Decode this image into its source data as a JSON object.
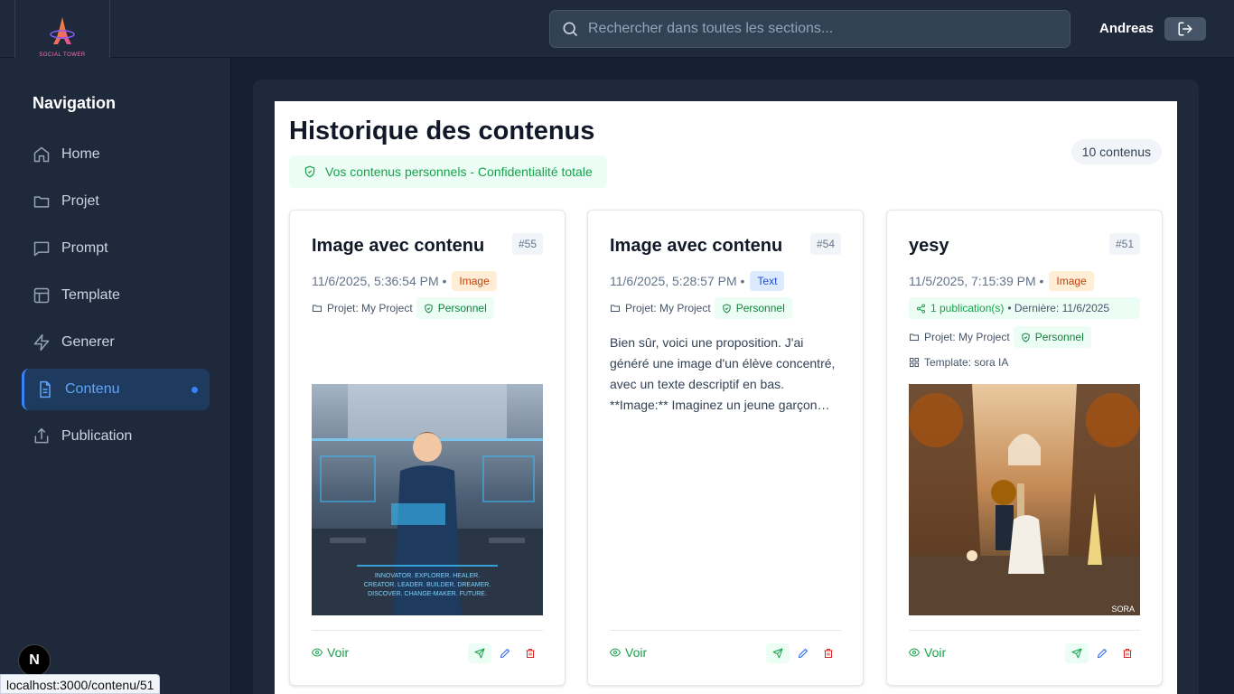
{
  "brand": {
    "logo_text": "SOCIAL TOWER"
  },
  "search": {
    "placeholder": "Rechercher dans toutes les sections..."
  },
  "user": {
    "name": "Andreas"
  },
  "sidebar": {
    "title": "Navigation",
    "items": [
      {
        "label": "Home",
        "icon": "home-icon"
      },
      {
        "label": "Projet",
        "icon": "folder-icon"
      },
      {
        "label": "Prompt",
        "icon": "message-icon"
      },
      {
        "label": "Template",
        "icon": "layout-icon"
      },
      {
        "label": "Generer",
        "icon": "zap-icon"
      },
      {
        "label": "Contenu",
        "icon": "file-text-icon",
        "active": true
      },
      {
        "label": "Publication",
        "icon": "share-icon"
      }
    ]
  },
  "page": {
    "title": "Historique des contenus",
    "privacy": "Vos contenus personnels - Confidentialité totale",
    "count": "10 contenus"
  },
  "cards": [
    {
      "title": "Image avec contenu",
      "id": "#55",
      "date": "11/6/2025, 5:36:54 PM •",
      "type": "Image",
      "project": "Projet: My Project",
      "privacy": "Personnel",
      "overlay_text": [
        "INNOVATOR. EXPLORER. HEALER.",
        "CREATOR. LEADER. BUILDER. DREAMER.",
        "DISCOVER. CHANGE-MAKER. FUTURE."
      ],
      "view_label": "Voir"
    },
    {
      "title": "Image avec contenu",
      "id": "#54",
      "date": "11/6/2025, 5:28:57 PM •",
      "type": "Text",
      "project": "Projet: My Project",
      "privacy": "Personnel",
      "text": "Bien sûr, voici une proposition. J'ai généré une image d'un élève concentré, avec un texte descriptif en bas. **Image:** Imaginez un jeune garçon…",
      "view_label": "Voir"
    },
    {
      "title": "yesy",
      "id": "#51",
      "date": "11/5/2025, 7:15:39 PM •",
      "type": "Image",
      "publications": "1 publication(s)",
      "last_pub": "• Dernière: 11/6/2025",
      "project": "Projet: My Project",
      "privacy": "Personnel",
      "template": "Template: sora IA",
      "watermark": "SORA",
      "view_label": "Voir"
    }
  ],
  "devtools": {
    "badge": "N"
  },
  "status_bar": {
    "url": "localhost:3000/contenu/51"
  }
}
